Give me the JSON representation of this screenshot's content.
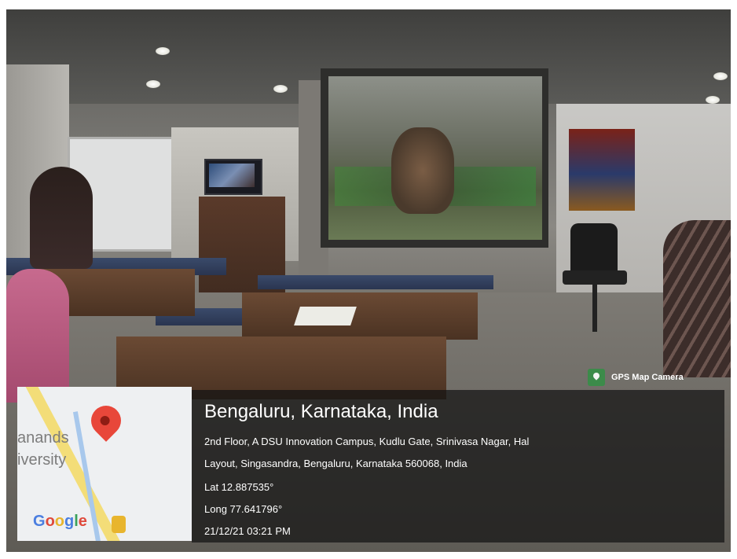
{
  "overlay": {
    "badge_label": "GPS Map Camera",
    "title": "Bengaluru, Karnataka, India",
    "address_line1": "2nd Floor, A DSU Innovation Campus, Kudlu Gate, Srinivasa Nagar, Hal",
    "address_line2": "Layout, Singasandra, Bengaluru, Karnataka 560068, India",
    "latitude": "Lat 12.887535°",
    "longitude": "Long 77.641796°",
    "timestamp": "21/12/21 03:21 PM"
  },
  "map": {
    "label_1": "anands",
    "label_2": "iversity",
    "brand_letters": [
      "G",
      "o",
      "o",
      "g",
      "l",
      "e"
    ],
    "pin_color": "#e8473a"
  },
  "colors": {
    "overlay_bg": "#141414",
    "badge_icon": "#3c8b4a"
  }
}
